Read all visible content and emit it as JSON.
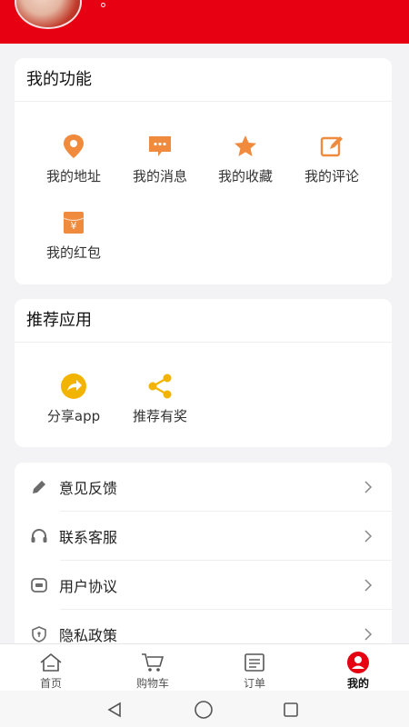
{
  "header": {
    "background_color": "#e60012"
  },
  "my_functions": {
    "title": "我的功能",
    "items": [
      {
        "label": "我的地址",
        "icon": "location-pin-icon"
      },
      {
        "label": "我的消息",
        "icon": "message-bubble-icon"
      },
      {
        "label": "我的收藏",
        "icon": "star-icon"
      },
      {
        "label": "我的评论",
        "icon": "edit-comment-icon"
      },
      {
        "label": "我的红包",
        "icon": "red-packet-icon"
      }
    ]
  },
  "recommended_apps": {
    "title": "推荐应用",
    "items": [
      {
        "label": "分享app",
        "icon": "share-arrow-icon"
      },
      {
        "label": "推荐有奖",
        "icon": "share-nodes-icon"
      }
    ]
  },
  "settings_list": {
    "items": [
      {
        "label": "意见反馈",
        "icon": "pencil-icon"
      },
      {
        "label": "联系客服",
        "icon": "headset-icon"
      },
      {
        "label": "用户协议",
        "icon": "agreement-icon"
      },
      {
        "label": "隐私政策",
        "icon": "shield-icon"
      }
    ]
  },
  "tabbar": {
    "tabs": [
      {
        "label": "首页",
        "icon": "home-icon"
      },
      {
        "label": "购物车",
        "icon": "cart-icon"
      },
      {
        "label": "订单",
        "icon": "order-list-icon"
      },
      {
        "label": "我的",
        "icon": "profile-icon",
        "active": true
      }
    ]
  },
  "colors": {
    "accent_red": "#e60012",
    "icon_orange": "#f08a3c",
    "icon_yellow": "#f2b400"
  }
}
